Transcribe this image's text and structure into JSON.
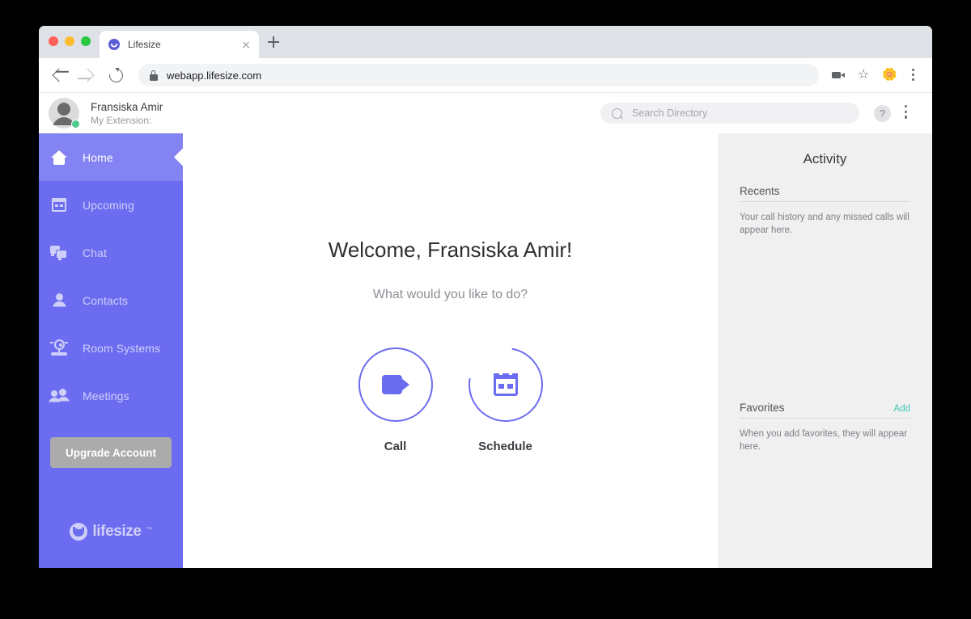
{
  "browser": {
    "tab": {
      "title": "Lifesize",
      "favicon": "lifesize-favicon"
    },
    "new_tab_label": "+",
    "url": "webapp.lifesize.com",
    "nav": {
      "back": "back-arrow",
      "forward": "forward-arrow",
      "reload": "reload"
    },
    "toolbar_icons": [
      "video-camera-icon",
      "bookmark-star-icon",
      "extension-icon",
      "browser-menu-icon"
    ]
  },
  "appbar": {
    "user_name": "Fransiska Amir",
    "extension_label": "My Extension:",
    "presence": "online",
    "search": {
      "placeholder": "Search Directory",
      "value": ""
    },
    "help_label": "?",
    "menu": "overflow-menu"
  },
  "sidebar": {
    "items": [
      {
        "label": "Home",
        "icon": "home-icon",
        "active": true
      },
      {
        "label": "Upcoming",
        "icon": "calendar-icon",
        "active": false
      },
      {
        "label": "Chat",
        "icon": "chat-bubbles-icon",
        "active": false
      },
      {
        "label": "Contacts",
        "icon": "person-icon",
        "active": false
      },
      {
        "label": "Room Systems",
        "icon": "webcam-icon",
        "active": false
      },
      {
        "label": "Meetings",
        "icon": "people-group-icon",
        "active": false
      }
    ],
    "upgrade_label": "Upgrade Account",
    "logo_text": "lifesize",
    "logo_tm": "™",
    "bg_color": "#6c6cf0",
    "active_bg_color": "#8383f4"
  },
  "main": {
    "welcome": "Welcome, Fransiska Amir!",
    "subtitle": "What would you like to do?",
    "actions": [
      {
        "label": "Call",
        "icon": "video-camera-icon",
        "ring": "full"
      },
      {
        "label": "Schedule",
        "icon": "calendar-icon",
        "ring": "arc"
      }
    ],
    "accent_color": "#6c6cf0"
  },
  "activity": {
    "title": "Activity",
    "sections": [
      {
        "title": "Recents",
        "action": "",
        "empty_text": "Your call history and any missed calls will appear here."
      },
      {
        "title": "Favorites",
        "action": "Add",
        "empty_text": "When you add favorites, they will appear here."
      }
    ],
    "link_color": "#3cc8b4"
  }
}
